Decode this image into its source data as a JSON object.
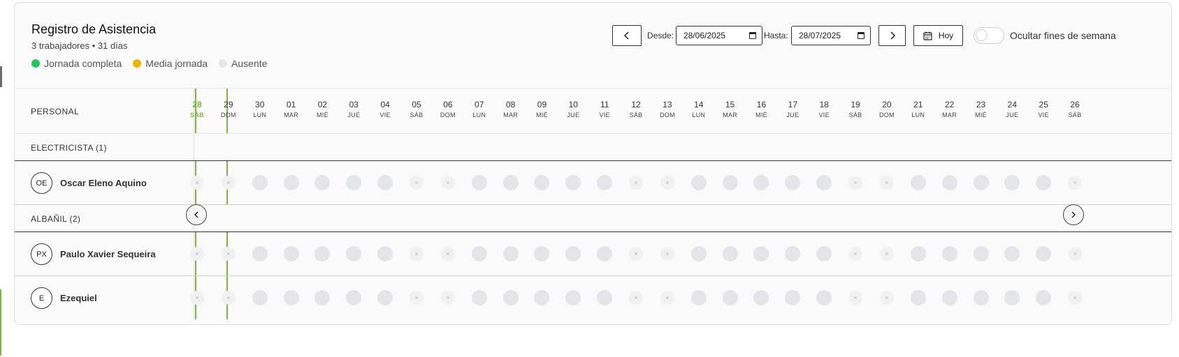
{
  "header": {
    "title": "Registro de Asistencia",
    "subtitle": "3 trabajadores • 31 días",
    "legend": [
      {
        "label": "Jornada completa",
        "color": "#22c55e"
      },
      {
        "label": "Media jornada",
        "color": "#eab308"
      },
      {
        "label": "Ausente",
        "color": "#e5e7eb"
      }
    ]
  },
  "controls": {
    "prev_icon": "chevron-left-icon",
    "desde_label": "Desde:",
    "desde_value": "28/06/2025",
    "hasta_label": "Hasta:",
    "hasta_value": "28/07/2025",
    "next_icon": "chevron-right-icon",
    "hoy_label": "Hoy",
    "toggle_label": "Ocultar fines de semana",
    "toggle_on": false
  },
  "table": {
    "personal_header": "PERSONAL",
    "today_index": 0,
    "days": [
      {
        "num": "28",
        "wd": "SÁB"
      },
      {
        "num": "29",
        "wd": "DOM"
      },
      {
        "num": "30",
        "wd": "LUN"
      },
      {
        "num": "01",
        "wd": "MAR"
      },
      {
        "num": "02",
        "wd": "MIÉ"
      },
      {
        "num": "03",
        "wd": "JUE"
      },
      {
        "num": "04",
        "wd": "VIE"
      },
      {
        "num": "05",
        "wd": "SÁB"
      },
      {
        "num": "06",
        "wd": "DOM"
      },
      {
        "num": "07",
        "wd": "LUN"
      },
      {
        "num": "08",
        "wd": "MAR"
      },
      {
        "num": "09",
        "wd": "MIÉ"
      },
      {
        "num": "10",
        "wd": "JUE"
      },
      {
        "num": "11",
        "wd": "VIE"
      },
      {
        "num": "12",
        "wd": "SÁB"
      },
      {
        "num": "13",
        "wd": "DOM"
      },
      {
        "num": "14",
        "wd": "LUN"
      },
      {
        "num": "15",
        "wd": "MAR"
      },
      {
        "num": "16",
        "wd": "MIÉ"
      },
      {
        "num": "17",
        "wd": "JUE"
      },
      {
        "num": "18",
        "wd": "VIE"
      },
      {
        "num": "19",
        "wd": "SÁB"
      },
      {
        "num": "20",
        "wd": "DOM"
      },
      {
        "num": "21",
        "wd": "LUN"
      },
      {
        "num": "22",
        "wd": "MAR"
      },
      {
        "num": "23",
        "wd": "MIÉ"
      },
      {
        "num": "24",
        "wd": "JUE"
      },
      {
        "num": "25",
        "wd": "VIE"
      },
      {
        "num": "26",
        "wd": "SÁB"
      }
    ],
    "weekend_mark": "×",
    "groups": [
      {
        "label": "ELECTRICISTA (1)",
        "workers": [
          {
            "initials": "OE",
            "name": "Oscar Eleno Aquino"
          }
        ]
      },
      {
        "label": "ALBAÑIL (2)",
        "workers": [
          {
            "initials": "PX",
            "name": "Paulo Xavier Sequeira"
          },
          {
            "initials": "E",
            "name": "Ezequiel"
          }
        ]
      }
    ],
    "scroll_left_icon": "chevron-left-icon",
    "scroll_right_icon": "chevron-right-icon"
  }
}
